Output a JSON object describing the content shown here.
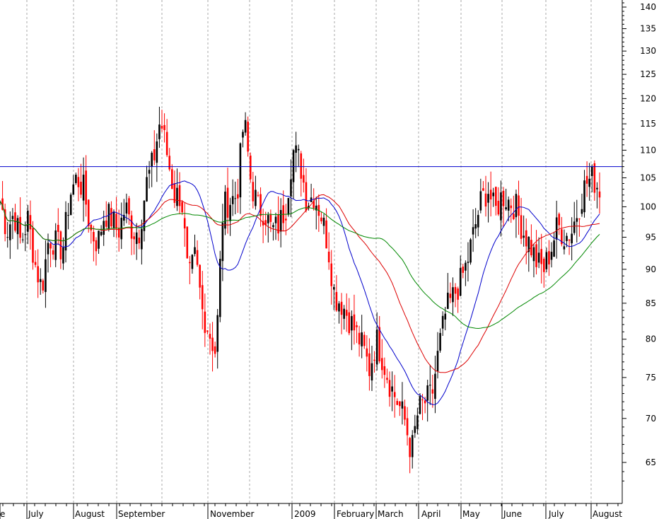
{
  "chart_data": {
    "type": "candlestick",
    "y_scale": "log",
    "ylim": [
      62,
      142
    ],
    "y_ticks": [
      140,
      135,
      130,
      125,
      120,
      115,
      110,
      105,
      100,
      95,
      90,
      85,
      80,
      75,
      70,
      65
    ],
    "x_tick_labels": [
      "e",
      "July",
      "August",
      "September",
      "November",
      "2009",
      "February",
      "March",
      "April",
      "May",
      "June",
      "July",
      "August"
    ],
    "horizontal_line": 107,
    "grid": "vertical dashed",
    "colors": {
      "up": "#000000",
      "down": "#ff0000",
      "ma_blue": "#0000cc",
      "ma_red": "#dd0000",
      "ma_green": "#008800",
      "hline": "#0000cc",
      "grid": "#aaaaaa"
    },
    "price_path": [
      101,
      96,
      99,
      94,
      98,
      91,
      87,
      95,
      94,
      93,
      102,
      105,
      103,
      96,
      94,
      99,
      98,
      96,
      100,
      96,
      96,
      104,
      108,
      116,
      109,
      102,
      102,
      88,
      92,
      84,
      81,
      78,
      100,
      101,
      102,
      116,
      104,
      100,
      99,
      96,
      97,
      100,
      110,
      108,
      101,
      102,
      99,
      94,
      86,
      85,
      83,
      81,
      79,
      76,
      80,
      77,
      74,
      72,
      70,
      66,
      71,
      72,
      73,
      79,
      84,
      86,
      88,
      91,
      96,
      101,
      103,
      99,
      102,
      101,
      100,
      96,
      94,
      91,
      90,
      93,
      97,
      95,
      96,
      100,
      104,
      105,
      103
    ]
  }
}
